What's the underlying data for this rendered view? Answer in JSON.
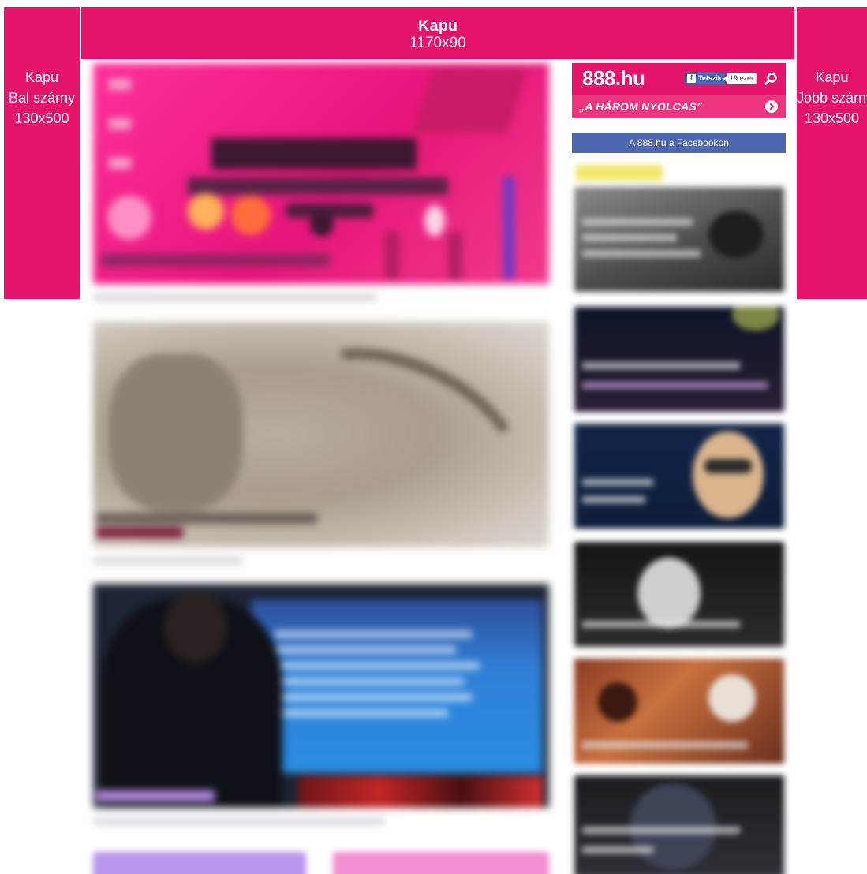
{
  "ads": {
    "top": {
      "name": "Kapu",
      "size": "1170x90"
    },
    "left": {
      "name": "Kapu",
      "position": "Bal szárny",
      "size": "130x500"
    },
    "right": {
      "name": "Kapu",
      "position": "Jobb szárny",
      "size": "130x500"
    },
    "color": "#e3146a"
  },
  "widget": {
    "brand": "888.hu",
    "like_label": "Tetszik",
    "like_count": "19 ezer",
    "slogan": "„A HÁROM NYOLCAS”",
    "facebook_link": "A 888.hu a Facebookon",
    "search_icon": "search-icon",
    "brand_color": "#e3146a",
    "facebook_color": "#4c67ad"
  },
  "main_articles": [
    {
      "kind": "promo-banner"
    },
    {
      "kind": "photo-story"
    },
    {
      "kind": "photo-story"
    }
  ],
  "side_articles_count": 6
}
